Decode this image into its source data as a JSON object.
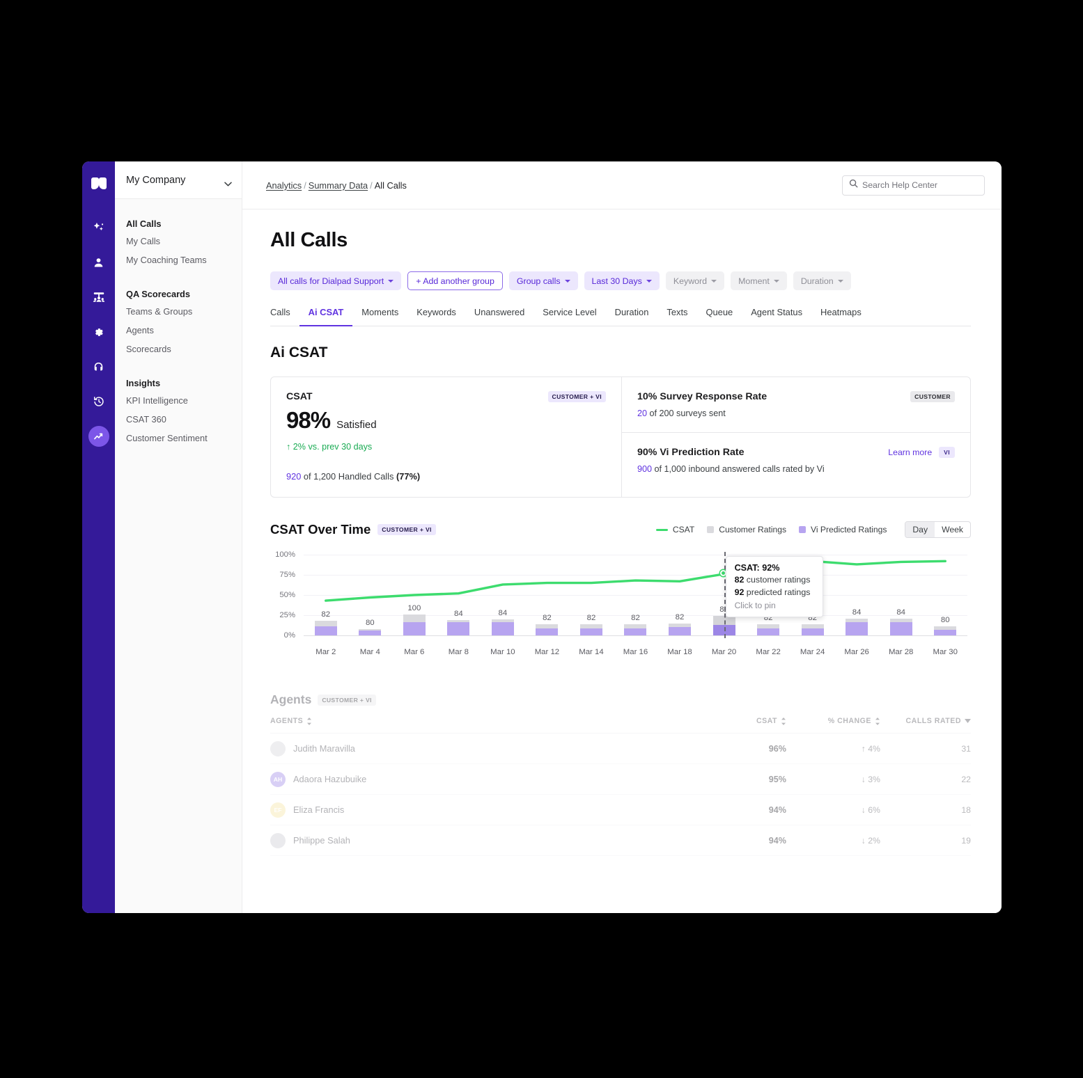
{
  "colors": {
    "rail_bg": "#341a99",
    "accent": "#6033e0",
    "chip_bg": "#ece7fd",
    "line": "#3ddc6e",
    "bar_customer": "#dadade",
    "bar_vi": "#b7a4f0"
  },
  "rail": {
    "logo": "dialpad-logo-icon",
    "items": [
      {
        "icon": "ai-sparkle-icon",
        "active": false
      },
      {
        "icon": "person-icon",
        "active": false
      },
      {
        "icon": "contact-center-icon",
        "active": false
      },
      {
        "icon": "gear-icon",
        "active": false
      },
      {
        "icon": "headset-icon",
        "active": false
      },
      {
        "icon": "history-clock-icon",
        "active": false
      },
      {
        "icon": "analytics-trend-icon",
        "active": true
      }
    ]
  },
  "nav": {
    "company": "My Company",
    "sections": [
      {
        "header": "All Calls",
        "links": [
          "My Calls",
          "My Coaching Teams"
        ]
      },
      {
        "header": "QA Scorecards",
        "links": [
          "Teams & Groups",
          "Agents",
          "Scorecards"
        ]
      },
      {
        "header": "Insights",
        "links": [
          "KPI Intelligence",
          "CSAT 360",
          "Customer Sentiment"
        ]
      }
    ]
  },
  "topbar": {
    "breadcrumb": {
      "items": [
        "Analytics",
        "Summary Data"
      ],
      "current": "All Calls",
      "separator": "/"
    },
    "search": {
      "placeholder": "Search Help Center",
      "value": "",
      "icon": "search-icon"
    }
  },
  "page": {
    "title": "All Calls",
    "filters": [
      {
        "label": "All calls for Dialpad Support",
        "style": "filled",
        "caret": true
      },
      {
        "label": "+ Add another group",
        "style": "outline",
        "caret": false
      },
      {
        "label": "Group calls",
        "style": "filled",
        "caret": true
      },
      {
        "label": "Last 30 Days",
        "style": "filled",
        "caret": true
      },
      {
        "label": "Keyword",
        "style": "muted",
        "caret": true
      },
      {
        "label": "Moment",
        "style": "muted",
        "caret": true
      },
      {
        "label": "Duration",
        "style": "muted",
        "caret": true
      }
    ],
    "tabs": [
      {
        "label": "Calls",
        "active": false
      },
      {
        "label": "Ai CSAT",
        "active": true
      },
      {
        "label": "Moments",
        "active": false
      },
      {
        "label": "Keywords",
        "active": false
      },
      {
        "label": "Unanswered",
        "active": false
      },
      {
        "label": "Service Level",
        "active": false
      },
      {
        "label": "Duration",
        "active": false
      },
      {
        "label": "Texts",
        "active": false
      },
      {
        "label": "Queue",
        "active": false
      },
      {
        "label": "Agent Status",
        "active": false
      },
      {
        "label": "Heatmaps",
        "active": false
      }
    ],
    "section_title": "Ai CSAT"
  },
  "kpi": {
    "csat": {
      "label": "CSAT",
      "badge": "CUSTOMER + VI",
      "value": "98%",
      "qualifier": "Satisfied",
      "delta": "↑ 2% vs. prev 30 days",
      "footer_lead": "920",
      "footer_rest": " of 1,200 Handled Calls ",
      "footer_bold": "(77%)"
    },
    "survey": {
      "title": "10% Survey Response Rate",
      "badge": "CUSTOMER",
      "sub_lead": "20",
      "sub_rest": " of 200 surveys sent"
    },
    "prediction": {
      "title": "90% Vi Prediction Rate",
      "learn_more": "Learn more",
      "badge": "VI",
      "sub_lead": "900",
      "sub_rest": " of 1,000 inbound answered calls rated by Vi"
    }
  },
  "chart_header": {
    "title": "CSAT Over Time",
    "badge": "CUSTOMER + VI",
    "legend": [
      {
        "label": "CSAT",
        "type": "line",
        "color": "#3ddc6e"
      },
      {
        "label": "Customer Ratings",
        "type": "box",
        "color": "#dadade"
      },
      {
        "label": "Vi Predicted Ratings",
        "type": "box",
        "color": "#b7a4f0"
      }
    ],
    "granularity": {
      "options": [
        "Day",
        "Week"
      ],
      "selected": "Day"
    }
  },
  "tooltip": {
    "title": "CSAT: 92%",
    "row1_bold": "82",
    "row1_rest": " customer ratings",
    "row2_bold": "92",
    "row2_rest": " predicted ratings",
    "pin": "Click to pin"
  },
  "chart_data": {
    "type": "bar",
    "title": "CSAT Over Time",
    "xlabel": "",
    "ylabel": "",
    "ylim": [
      0,
      100
    ],
    "yticks": [
      "0%",
      "25%",
      "50%",
      "75%",
      "100%"
    ],
    "grid": true,
    "legend_position": "top-right",
    "categories": [
      "Mar 2",
      "Mar 4",
      "Mar 6",
      "Mar 8",
      "Mar 10",
      "Mar 12",
      "Mar 14",
      "Mar 16",
      "Mar 18",
      "Mar 20",
      "Mar 22",
      "Mar 24",
      "Mar 26",
      "Mar 28",
      "Mar 30"
    ],
    "bar_labels": [
      82,
      80,
      100,
      84,
      84,
      82,
      82,
      82,
      82,
      82,
      82,
      82,
      84,
      84,
      80
    ],
    "series": [
      {
        "name": "Vi Predicted Ratings",
        "type": "bar-segment",
        "color": "#b7a4f0",
        "values": [
          11,
          6,
          16,
          16,
          16,
          9,
          9,
          9,
          10,
          13,
          9,
          9,
          16,
          16,
          7
        ]
      },
      {
        "name": "Customer Ratings",
        "type": "bar-segment",
        "color": "#dadade",
        "values": [
          7,
          2,
          10,
          3,
          4,
          5,
          5,
          5,
          5,
          11,
          5,
          5,
          5,
          5,
          4
        ]
      },
      {
        "name": "CSAT",
        "type": "line",
        "color": "#3ddc6e",
        "values": [
          43,
          47,
          50,
          52,
          63,
          65,
          65,
          68,
          67,
          76,
          88,
          92,
          88,
          91,
          92
        ]
      }
    ],
    "highlight_category": "Mar 20",
    "annotation": "CSAT: 92% / 82 customer ratings / 92 predicted ratings / Click to pin"
  },
  "agents": {
    "title": "Agents",
    "badge": "CUSTOMER + VI",
    "columns": [
      "AGENTS",
      "CSAT",
      "% CHANGE",
      "CALLS RATED"
    ],
    "rows": [
      {
        "name": "Judith Maravilla",
        "initials": "",
        "avatar_color": "#d8d8dd",
        "csat": "96%",
        "change": "↑ 4%",
        "calls": "31"
      },
      {
        "name": "Adaora Hazubuike",
        "initials": "AH",
        "avatar_color": "#a48ee8",
        "csat": "95%",
        "change": "↓ 3%",
        "calls": "22"
      },
      {
        "name": "Eliza Francis",
        "initials": "EF",
        "avatar_color": "#f6e6a8",
        "csat": "94%",
        "change": "↓ 6%",
        "calls": "18"
      },
      {
        "name": "Philippe Salah",
        "initials": "",
        "avatar_color": "#cfcfd5",
        "csat": "94%",
        "change": "↓ 2%",
        "calls": "19"
      }
    ]
  }
}
